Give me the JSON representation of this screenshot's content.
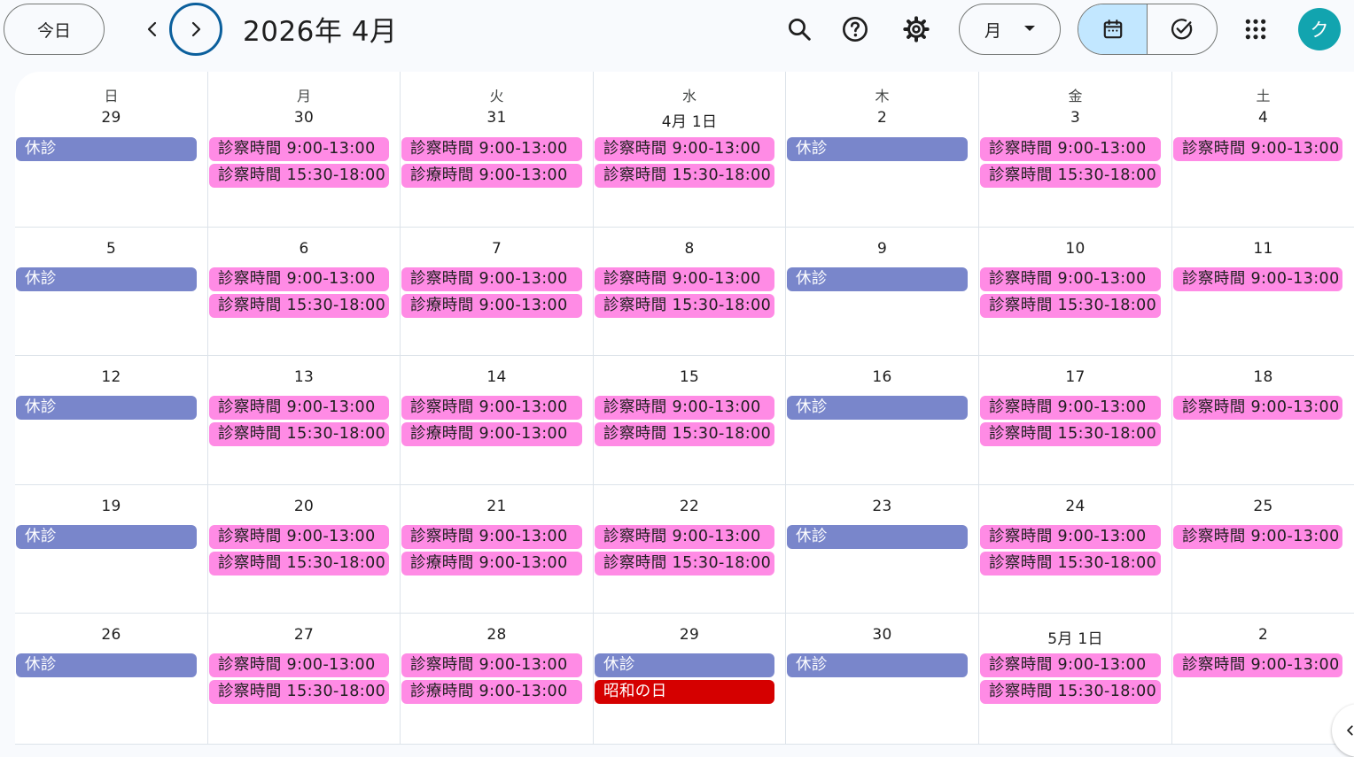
{
  "header": {
    "today_label": "今日",
    "month_title": "2026年 4月",
    "view_label": "月",
    "avatar_letter": "ク"
  },
  "colors": {
    "closed": "#7986cb",
    "hours": "#ff8be5",
    "holiday": "#d50000",
    "selected_segment": "#c2e7ff",
    "avatar": "#12a4af"
  },
  "icons": {
    "prev": "chevron-left-icon",
    "next": "chevron-right-icon",
    "search": "search-icon",
    "help": "help-icon",
    "settings": "gear-icon",
    "calendar": "calendar-icon",
    "tasks": "task-check-icon",
    "apps": "apps-grid-icon"
  },
  "weekdays": [
    "日",
    "月",
    "火",
    "水",
    "木",
    "金",
    "土"
  ],
  "weeks": [
    [
      {
        "day": "29",
        "events": [
          {
            "type": "closed",
            "text": "休診"
          }
        ]
      },
      {
        "day": "30",
        "events": [
          {
            "type": "hours",
            "text": "診察時間 9:00-13:00"
          },
          {
            "type": "hours",
            "text": "診察時間 15:30-18:00"
          }
        ]
      },
      {
        "day": "31",
        "events": [
          {
            "type": "hours",
            "text": "診察時間 9:00-13:00"
          },
          {
            "type": "hours",
            "text": "診療時間 9:00-13:00"
          }
        ]
      },
      {
        "day": "4月 1日",
        "events": [
          {
            "type": "hours",
            "text": "診察時間 9:00-13:00"
          },
          {
            "type": "hours",
            "text": "診察時間 15:30-18:00"
          }
        ]
      },
      {
        "day": "2",
        "events": [
          {
            "type": "closed",
            "text": "休診"
          }
        ]
      },
      {
        "day": "3",
        "events": [
          {
            "type": "hours",
            "text": "診察時間 9:00-13:00"
          },
          {
            "type": "hours",
            "text": "診察時間 15:30-18:00"
          }
        ]
      },
      {
        "day": "4",
        "events": [
          {
            "type": "hours",
            "text": "診察時間 9:00-13:00"
          }
        ]
      }
    ],
    [
      {
        "day": "5",
        "events": [
          {
            "type": "closed",
            "text": "休診"
          }
        ]
      },
      {
        "day": "6",
        "events": [
          {
            "type": "hours",
            "text": "診察時間 9:00-13:00"
          },
          {
            "type": "hours",
            "text": "診察時間 15:30-18:00"
          }
        ]
      },
      {
        "day": "7",
        "events": [
          {
            "type": "hours",
            "text": "診察時間 9:00-13:00"
          },
          {
            "type": "hours",
            "text": "診療時間 9:00-13:00"
          }
        ]
      },
      {
        "day": "8",
        "events": [
          {
            "type": "hours",
            "text": "診察時間 9:00-13:00"
          },
          {
            "type": "hours",
            "text": "診察時間 15:30-18:00"
          }
        ]
      },
      {
        "day": "9",
        "events": [
          {
            "type": "closed",
            "text": "休診"
          }
        ]
      },
      {
        "day": "10",
        "events": [
          {
            "type": "hours",
            "text": "診察時間 9:00-13:00"
          },
          {
            "type": "hours",
            "text": "診察時間 15:30-18:00"
          }
        ]
      },
      {
        "day": "11",
        "events": [
          {
            "type": "hours",
            "text": "診察時間 9:00-13:00"
          }
        ]
      }
    ],
    [
      {
        "day": "12",
        "events": [
          {
            "type": "closed",
            "text": "休診"
          }
        ]
      },
      {
        "day": "13",
        "events": [
          {
            "type": "hours",
            "text": "診察時間 9:00-13:00"
          },
          {
            "type": "hours",
            "text": "診察時間 15:30-18:00"
          }
        ]
      },
      {
        "day": "14",
        "events": [
          {
            "type": "hours",
            "text": "診察時間 9:00-13:00"
          },
          {
            "type": "hours",
            "text": "診療時間 9:00-13:00"
          }
        ]
      },
      {
        "day": "15",
        "events": [
          {
            "type": "hours",
            "text": "診察時間 9:00-13:00"
          },
          {
            "type": "hours",
            "text": "診察時間 15:30-18:00"
          }
        ]
      },
      {
        "day": "16",
        "events": [
          {
            "type": "closed",
            "text": "休診"
          }
        ]
      },
      {
        "day": "17",
        "events": [
          {
            "type": "hours",
            "text": "診察時間 9:00-13:00"
          },
          {
            "type": "hours",
            "text": "診察時間 15:30-18:00"
          }
        ]
      },
      {
        "day": "18",
        "events": [
          {
            "type": "hours",
            "text": "診察時間 9:00-13:00"
          }
        ]
      }
    ],
    [
      {
        "day": "19",
        "events": [
          {
            "type": "closed",
            "text": "休診"
          }
        ]
      },
      {
        "day": "20",
        "events": [
          {
            "type": "hours",
            "text": "診察時間 9:00-13:00"
          },
          {
            "type": "hours",
            "text": "診察時間 15:30-18:00"
          }
        ]
      },
      {
        "day": "21",
        "events": [
          {
            "type": "hours",
            "text": "診察時間 9:00-13:00"
          },
          {
            "type": "hours",
            "text": "診療時間 9:00-13:00"
          }
        ]
      },
      {
        "day": "22",
        "events": [
          {
            "type": "hours",
            "text": "診察時間 9:00-13:00"
          },
          {
            "type": "hours",
            "text": "診察時間 15:30-18:00"
          }
        ]
      },
      {
        "day": "23",
        "events": [
          {
            "type": "closed",
            "text": "休診"
          }
        ]
      },
      {
        "day": "24",
        "events": [
          {
            "type": "hours",
            "text": "診察時間 9:00-13:00"
          },
          {
            "type": "hours",
            "text": "診察時間 15:30-18:00"
          }
        ]
      },
      {
        "day": "25",
        "events": [
          {
            "type": "hours",
            "text": "診察時間 9:00-13:00"
          }
        ]
      }
    ],
    [
      {
        "day": "26",
        "events": [
          {
            "type": "closed",
            "text": "休診"
          }
        ]
      },
      {
        "day": "27",
        "events": [
          {
            "type": "hours",
            "text": "診察時間 9:00-13:00"
          },
          {
            "type": "hours",
            "text": "診察時間 15:30-18:00"
          }
        ]
      },
      {
        "day": "28",
        "events": [
          {
            "type": "hours",
            "text": "診察時間 9:00-13:00"
          },
          {
            "type": "hours",
            "text": "診療時間 9:00-13:00"
          }
        ]
      },
      {
        "day": "29",
        "events": [
          {
            "type": "closed",
            "text": "休診"
          },
          {
            "type": "holiday",
            "text": "昭和の日"
          }
        ]
      },
      {
        "day": "30",
        "events": [
          {
            "type": "closed",
            "text": "休診"
          }
        ]
      },
      {
        "day": "5月 1日",
        "events": [
          {
            "type": "hours",
            "text": "診察時間 9:00-13:00"
          },
          {
            "type": "hours",
            "text": "診察時間 15:30-18:00"
          }
        ]
      },
      {
        "day": "2",
        "events": [
          {
            "type": "hours",
            "text": "診察時間 9:00-13:00"
          }
        ]
      }
    ]
  ]
}
